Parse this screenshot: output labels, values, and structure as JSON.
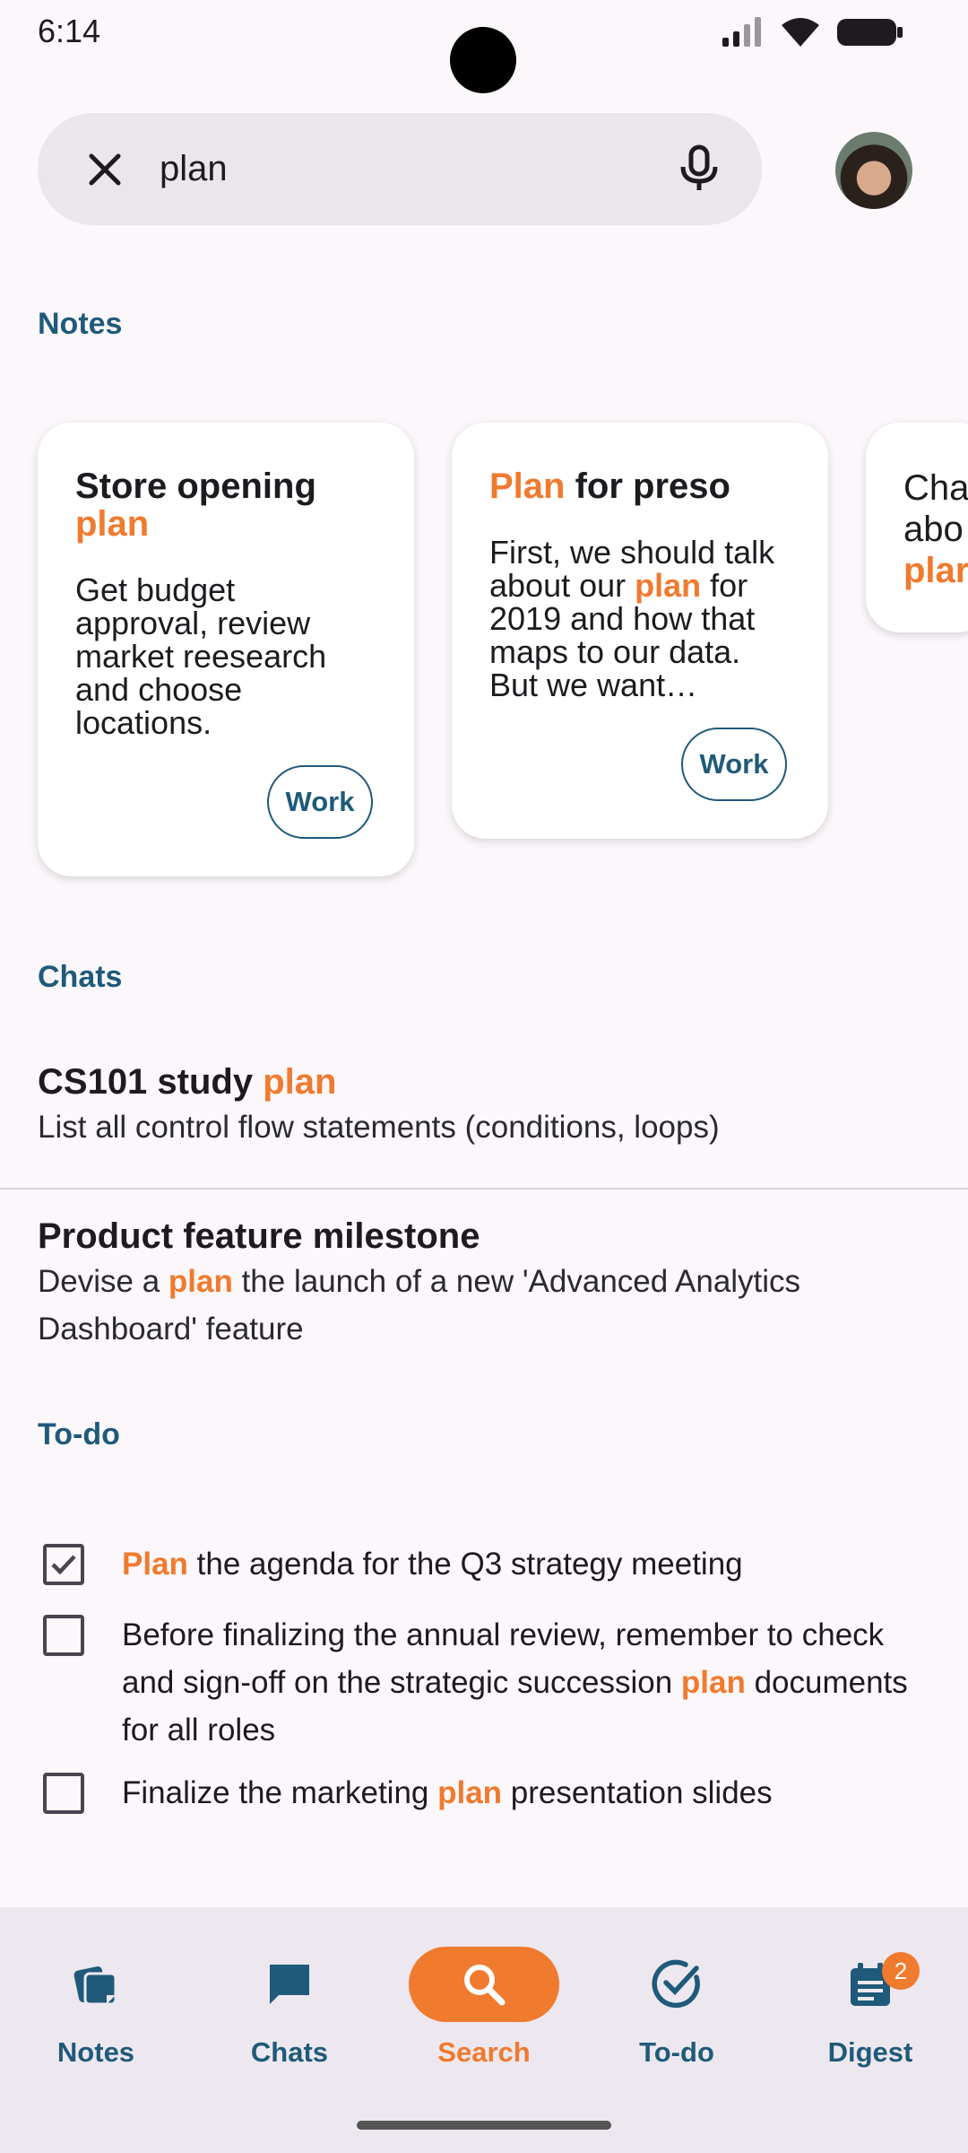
{
  "status": {
    "time": "6:14"
  },
  "search": {
    "query": "plan"
  },
  "sections": {
    "notes": "Notes",
    "chats": "Chats",
    "todo": "To-do"
  },
  "notes": [
    {
      "title_pre": "Store opening ",
      "title_hl": "plan",
      "title_post": "",
      "body_pre": "Get budget approval, review market reesearch and choose locations.",
      "body_hl": "",
      "body_post": "",
      "chip": "Work"
    },
    {
      "title_pre": "",
      "title_hl": "Plan",
      "title_post": " for preso",
      "body_pre": "First, we should talk about our ",
      "body_hl": "plan",
      "body_post": " for 2019 and how that maps to our data. But we want…",
      "chip": "Work"
    },
    {
      "line1": "Cha",
      "line2": "abo",
      "line3": "plar"
    }
  ],
  "chats": [
    {
      "title_pre": "CS101 study ",
      "title_hl": "plan",
      "sub_pre": "List all control flow statements (conditions, loops)",
      "sub_hl": "",
      "sub_post": ""
    },
    {
      "title_pre": "Product feature milestone",
      "title_hl": "",
      "sub_pre": "Devise a ",
      "sub_hl": "plan",
      "sub_post": " the launch of a new 'Advanced Analytics Dashboard' feature"
    }
  ],
  "todos": [
    {
      "checked": true,
      "pre": "",
      "hl": "Plan",
      "post": " the agenda for the Q3 strategy meeting"
    },
    {
      "checked": false,
      "pre": "Before finalizing the annual review, remember to check and sign-off on the strategic succession ",
      "hl": "plan",
      "post": " documents for all roles"
    },
    {
      "checked": false,
      "pre": "Finalize the marketing ",
      "hl": "plan",
      "post": " presentation slides"
    }
  ],
  "nav": {
    "notes": "Notes",
    "chats": "Chats",
    "search": "Search",
    "todo": "To-do",
    "digest": "Digest",
    "digest_badge": "2"
  },
  "colors": {
    "accent": "#f07a2e",
    "primary": "#1f5a7a",
    "background": "#fbf7fb"
  }
}
